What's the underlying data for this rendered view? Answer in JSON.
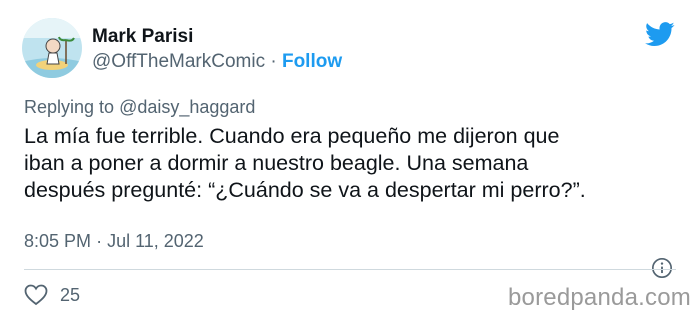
{
  "author": {
    "name": "Mark Parisi",
    "handle": "@OffTheMarkComic",
    "separator": "·",
    "follow_label": "Follow"
  },
  "reply": {
    "prefix": "Replying to",
    "to": "@daisy_haggard"
  },
  "tweet": {
    "lines": [
      "La mía fue terrible. Cuando era pequeño me dijeron que",
      "iban a poner a dormir a nuestro beagle. Una semana",
      "después pregunté: “¿Cuándo se va a despertar mi perro?”."
    ]
  },
  "meta": {
    "time": "8:05 PM",
    "separator": "·",
    "date": "Jul 11, 2022"
  },
  "actions": {
    "like_count": "25"
  },
  "watermark": "boredpanda.com",
  "colors": {
    "brand": "#1d9bf0",
    "secondary_text": "#536471",
    "primary_text": "#0f1419"
  },
  "icons": {
    "logo": "twitter-bird-icon",
    "info": "info-icon",
    "like": "heart-icon"
  }
}
